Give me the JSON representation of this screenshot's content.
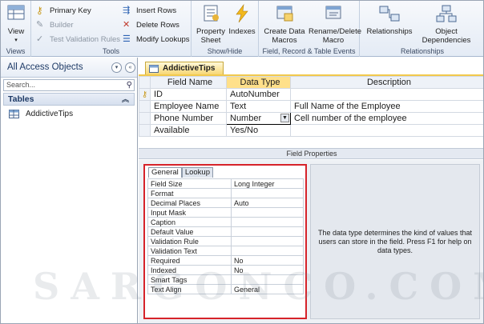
{
  "ribbon": {
    "views": {
      "view_label": "View",
      "group": "Views"
    },
    "tools": {
      "primary_key": "Primary Key",
      "builder": "Builder",
      "test_validation": "Test Validation Rules",
      "insert_rows": "Insert Rows",
      "delete_rows": "Delete Rows",
      "modify_lookups": "Modify Lookups",
      "group": "Tools"
    },
    "show_hide": {
      "property_sheet": "Property Sheet",
      "indexes": "Indexes",
      "group": "Show/Hide"
    },
    "field_events": {
      "create_macros": "Create Data Macros",
      "rename_macro": "Rename/Delete Macro",
      "group": "Field, Record & Table Events"
    },
    "relationships": {
      "relationships": "Relationships",
      "object_dependencies": "Object Dependencies",
      "group": "Relationships"
    }
  },
  "nav": {
    "title": "All Access Objects",
    "search_placeholder": "Search...",
    "section": "Tables",
    "items": [
      "AddictiveTips"
    ]
  },
  "document": {
    "tab": "AddictiveTips",
    "headers": [
      "Field Name",
      "Data Type",
      "Description"
    ],
    "rows": [
      {
        "name": "ID",
        "type": "AutoNumber",
        "desc": ""
      },
      {
        "name": "Employee Name",
        "type": "Text",
        "desc": "Full Name of the Employee"
      },
      {
        "name": "Phone Number",
        "type": "Number",
        "desc": "Cell number of the employee"
      },
      {
        "name": "Available",
        "type": "Yes/No",
        "desc": ""
      }
    ]
  },
  "field_properties": {
    "title": "Field Properties",
    "tabs": [
      "General",
      "Lookup"
    ],
    "props": [
      [
        "Field Size",
        "Long Integer"
      ],
      [
        "Format",
        ""
      ],
      [
        "Decimal Places",
        "Auto"
      ],
      [
        "Input Mask",
        ""
      ],
      [
        "Caption",
        ""
      ],
      [
        "Default Value",
        ""
      ],
      [
        "Validation Rule",
        ""
      ],
      [
        "Validation Text",
        ""
      ],
      [
        "Required",
        "No"
      ],
      [
        "Indexed",
        "No"
      ],
      [
        "Smart Tags",
        ""
      ],
      [
        "Text Align",
        "General"
      ]
    ],
    "help": "The data type determines the kind of values that users can store in the field. Press F1 for help on data types."
  },
  "watermark": "SARGONCO.COM",
  "colors": {
    "accent_tab": "#f7d775",
    "highlight_border": "#d6232a"
  }
}
